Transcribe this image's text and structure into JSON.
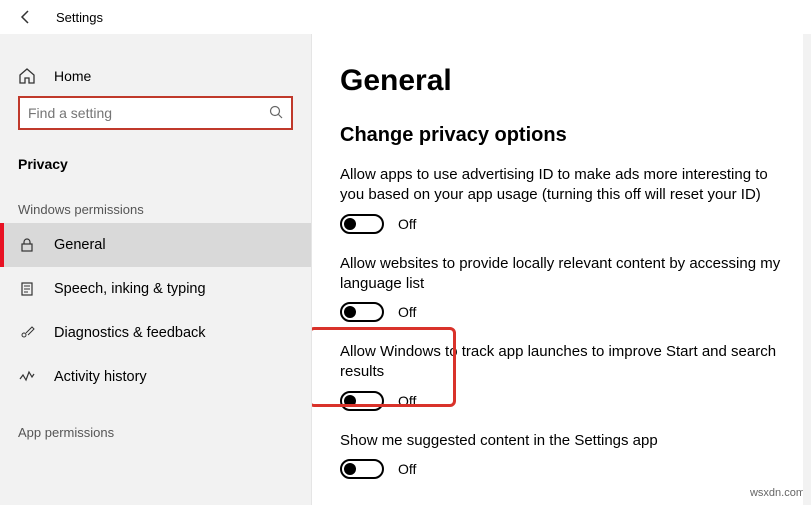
{
  "window": {
    "title": "Settings"
  },
  "sidebar": {
    "home": "Home",
    "search_placeholder": "Find a setting",
    "category": "Privacy",
    "section1": "Windows permissions",
    "section2": "App permissions",
    "items": {
      "general": "General",
      "speech": "Speech, inking & typing",
      "diag": "Diagnostics & feedback",
      "activity": "Activity history"
    }
  },
  "page": {
    "heading": "General",
    "subheading": "Change privacy options",
    "opts": {
      "ad": {
        "desc": "Allow apps to use advertising ID to make ads more interesting to you based on your app usage (turning this off will reset your ID)",
        "state": "Off"
      },
      "web": {
        "desc": "Allow websites to provide locally relevant content by accessing my language list",
        "state": "Off"
      },
      "launch": {
        "desc": "Allow Windows to track app launches to improve Start and search results",
        "state": "Off"
      },
      "suggest": {
        "desc": "Show me suggested content in the Settings app",
        "state": "Off"
      }
    }
  },
  "watermark": "wsxdn.com"
}
